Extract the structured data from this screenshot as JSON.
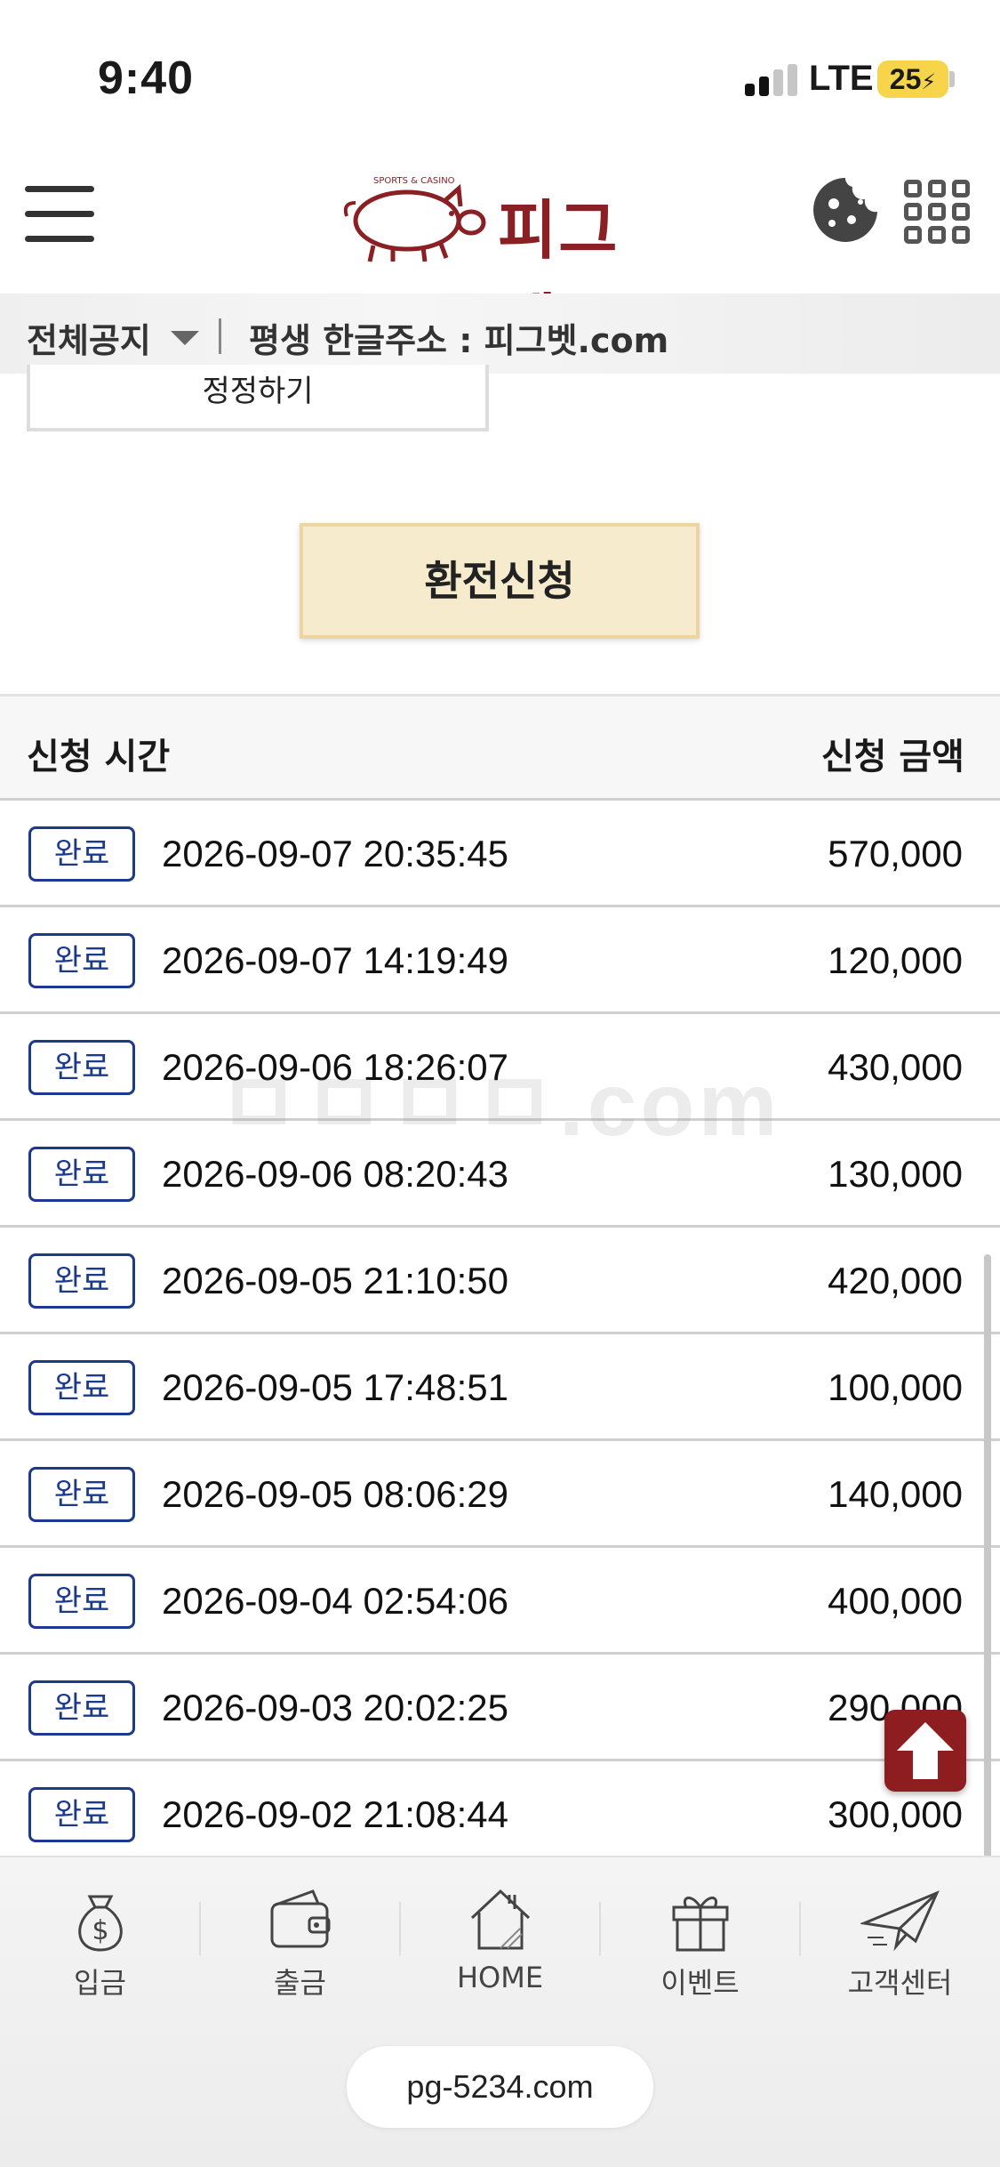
{
  "status_bar": {
    "time": "9:40",
    "network": "LTE",
    "battery": "25"
  },
  "header": {
    "logo_text": "피그벳",
    "logo_tagline": "SPORTS & CASINO"
  },
  "notice": {
    "category": "전체공지",
    "text": "평생 한글주소 : 피그벳.com"
  },
  "form": {
    "correct_label": "정정하기",
    "submit_label": "환전신청"
  },
  "table": {
    "col_time": "신청 시간",
    "col_amount": "신청 금액",
    "rows": [
      {
        "status": "완료",
        "datetime": "2026-09-07 20:35:45",
        "amount": "570,000"
      },
      {
        "status": "완료",
        "datetime": "2026-09-07 14:19:49",
        "amount": "120,000"
      },
      {
        "status": "완료",
        "datetime": "2026-09-06 18:26:07",
        "amount": "430,000"
      },
      {
        "status": "완료",
        "datetime": "2026-09-06 08:20:43",
        "amount": "130,000"
      },
      {
        "status": "완료",
        "datetime": "2026-09-05 21:10:50",
        "amount": "420,000"
      },
      {
        "status": "완료",
        "datetime": "2026-09-05 17:48:51",
        "amount": "100,000"
      },
      {
        "status": "완료",
        "datetime": "2026-09-05 08:06:29",
        "amount": "140,000"
      },
      {
        "status": "완료",
        "datetime": "2026-09-04 02:54:06",
        "amount": "400,000"
      },
      {
        "status": "완료",
        "datetime": "2026-09-03 20:02:25",
        "amount": "290,000"
      },
      {
        "status": "완료",
        "datetime": "2026-09-02 21:08:44",
        "amount": "300,000"
      }
    ]
  },
  "watermark": "ㅁㅁㅁㅁ.com",
  "bottom_nav": {
    "items": [
      {
        "label": "입금",
        "icon": "money-bag-icon"
      },
      {
        "label": "출금",
        "icon": "wallet-icon"
      },
      {
        "label": "HOME",
        "icon": "house-icon"
      },
      {
        "label": "이벤트",
        "icon": "gift-icon"
      },
      {
        "label": "고객센터",
        "icon": "paper-plane-icon"
      }
    ]
  },
  "browser": {
    "url": "pg-5234.com"
  },
  "colors": {
    "brand": "#8a1f24",
    "badge": "#1c3a8c",
    "submit_bg": "#f7ebcd"
  }
}
